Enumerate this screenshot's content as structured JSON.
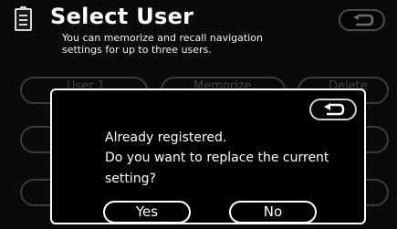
{
  "header": {
    "title": "Select User",
    "subtitle": "You can memorize and recall navigation settings for up to three users.",
    "icon": "document-icon"
  },
  "background_buttons": {
    "user1": "User 1",
    "memorize": "Memorize",
    "delete": "Delete"
  },
  "dialog": {
    "line1": "Already registered.",
    "line2": "Do you want to replace the current",
    "line3": "setting?",
    "yes_label": "Yes",
    "no_label": "No",
    "back_icon": "return-arrow-icon"
  },
  "colors": {
    "background": "#0a0a0a",
    "text": "#ffffff",
    "dim_border": "#3a3a3a"
  }
}
